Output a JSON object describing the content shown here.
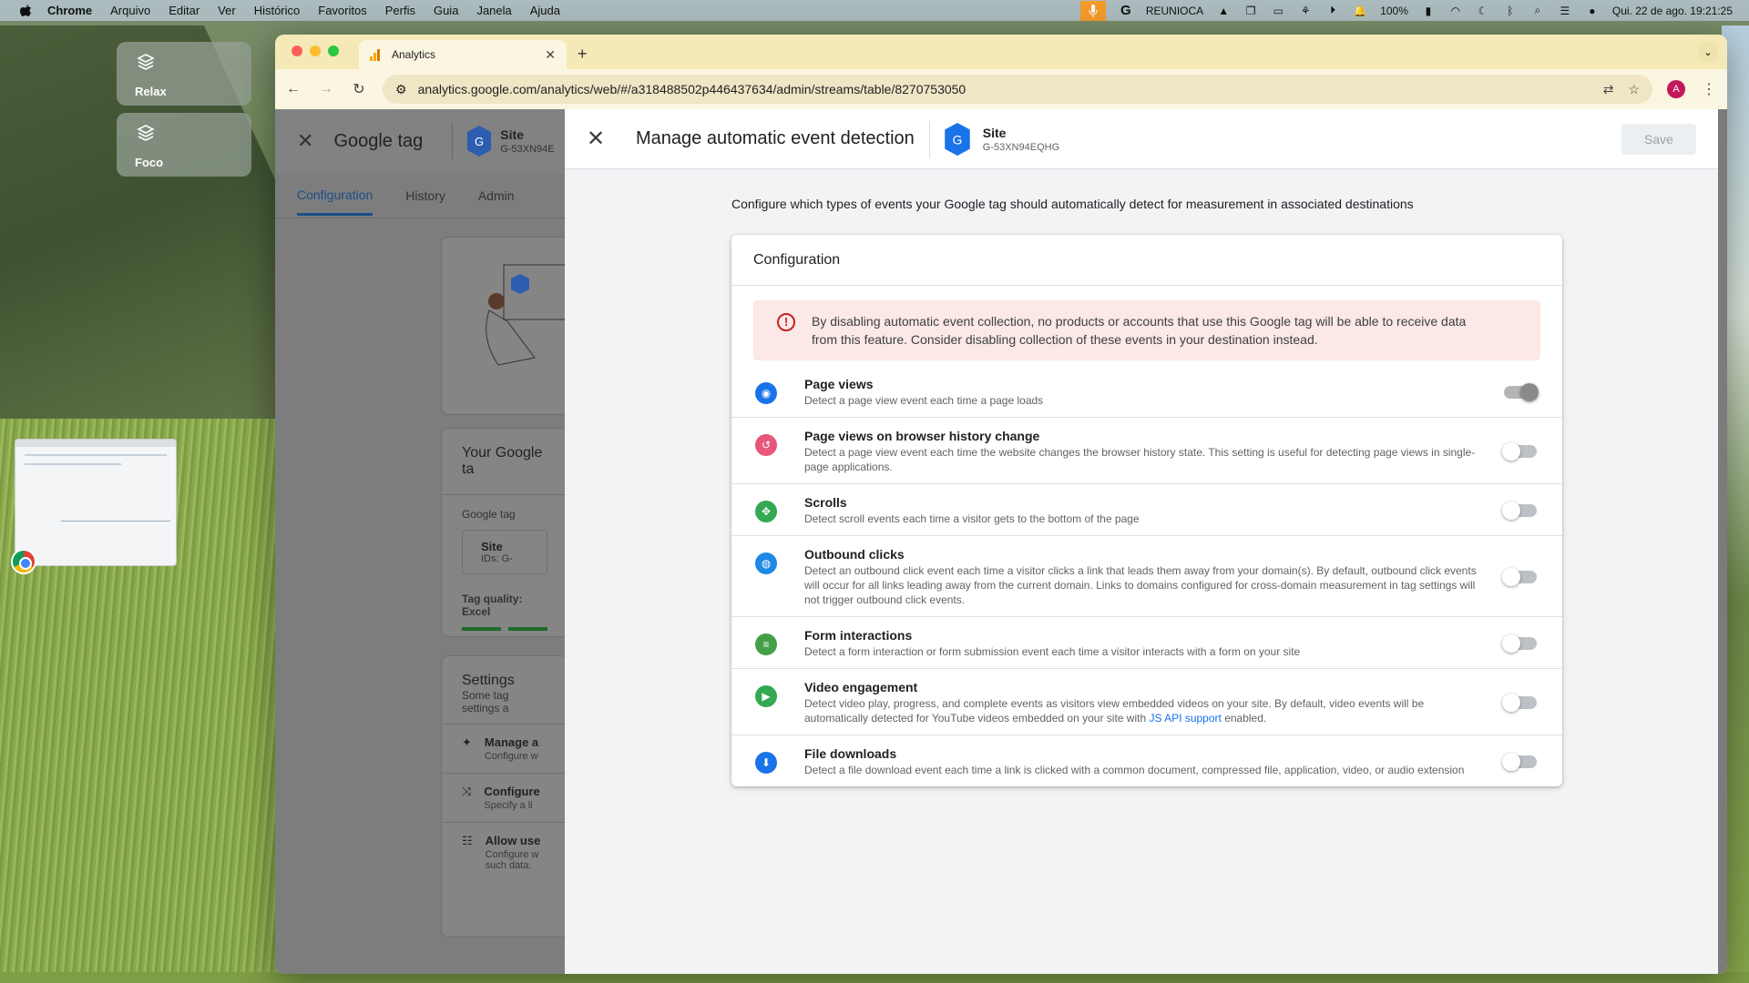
{
  "menubar": {
    "app": "Chrome",
    "items": [
      "Arquivo",
      "Editar",
      "Ver",
      "Histórico",
      "Favoritos",
      "Perfis",
      "Guia",
      "Janela",
      "Ajuda"
    ],
    "status_name": "REUNIOCA",
    "battery": "100%",
    "datetime": "Qui. 22 de ago.  19:21:25"
  },
  "stage": {
    "cards": [
      "Relax",
      "Foco"
    ]
  },
  "browser": {
    "tab_title": "Analytics",
    "url": "analytics.google.com/analytics/web/#/a318488502p446437634/admin/streams/table/8270753050",
    "profile_initial": "A"
  },
  "underlay": {
    "title": "Google tag",
    "site_name": "Site",
    "site_id": "G-53XN94E",
    "tabs": [
      "Configuration",
      "History",
      "Admin"
    ],
    "your_tag": "Your Google ta",
    "google_tag_label": "Google tag",
    "tag_site": "Site",
    "tag_ids": "IDs: G-",
    "tag_quality": "Tag quality: Excel",
    "settings_title": "Settings",
    "settings_sub": "Some tag settings a",
    "list": [
      {
        "title": "Manage a",
        "desc": "Configure w"
      },
      {
        "title": "Configure",
        "desc": "Specify a li"
      },
      {
        "title": "Allow use",
        "desc": "Configure w such data."
      }
    ]
  },
  "drawer": {
    "title": "Manage automatic event detection",
    "site_name": "Site",
    "site_id": "G-53XN94EQHG",
    "save": "Save",
    "intro": "Configure which types of events your Google tag should automatically detect for measurement in associated destinations",
    "card_title": "Configuration",
    "alert": "By disabling automatic event collection, no products or accounts that use this Google tag will be able to receive data from this feature. Consider disabling collection of these events in your destination instead.",
    "events": [
      {
        "title": "Page views",
        "desc": "Detect a page view event each time a page loads",
        "color": "#1a73e8",
        "icon": "eye-icon",
        "glyph": "◉",
        "on": true
      },
      {
        "title": "Page views on browser history change",
        "desc": "Detect a page view event each time the website changes the browser history state. This setting is useful for detecting page views in single-page applications.",
        "color": "#e8567c",
        "icon": "history-icon",
        "glyph": "↺",
        "on": false
      },
      {
        "title": "Scrolls",
        "desc": "Detect scroll events each time a visitor gets to the bottom of the page",
        "color": "#34a853",
        "icon": "scroll-icon",
        "glyph": "✥",
        "on": false
      },
      {
        "title": "Outbound clicks",
        "desc": "Detect an outbound click event each time a visitor clicks a link that leads them away from your domain(s). By default, outbound click events will occur for all links leading away from the current domain. Links to domains configured for cross-domain measurement in tag settings will not trigger outbound click events.",
        "color": "#1e88e5",
        "icon": "globe-icon",
        "glyph": "◍",
        "on": false
      },
      {
        "title": "Form interactions",
        "desc": "Detect a form interaction or form submission event each time a visitor interacts with a form on your site",
        "color": "#43a047",
        "icon": "form-icon",
        "glyph": "≡",
        "on": false
      },
      {
        "title": "Video engagement",
        "desc_before": "Detect video play, progress, and complete events as visitors view embedded videos on your site. By default, video events will be automatically detected for YouTube videos embedded on your site with ",
        "link": "JS API support",
        "desc_after": " enabled.",
        "color": "#34a853",
        "icon": "play-icon",
        "glyph": "▶",
        "on": false
      },
      {
        "title": "File downloads",
        "desc": "Detect a file download event each time a link is clicked with a common document, compressed file, application, video, or audio extension",
        "color": "#1a73e8",
        "icon": "download-icon",
        "glyph": "⬇",
        "on": false
      }
    ]
  }
}
